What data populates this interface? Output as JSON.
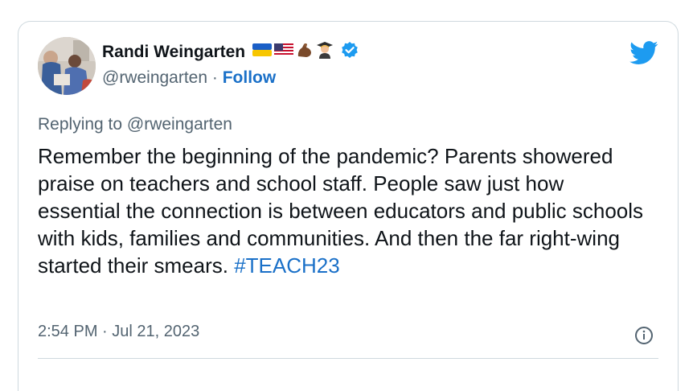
{
  "author": {
    "name": "Randi Weingarten",
    "handle": "@rweingarten",
    "separator": "·",
    "follow_label": "Follow",
    "emoji_icons": [
      "ukraine-flag-icon",
      "us-flag-icon",
      "flexed-biceps-icon",
      "graduate-icon"
    ],
    "verified": true
  },
  "tweet": {
    "replying_to": "Replying to @rweingarten",
    "text": "Remember the beginning of the pandemic? Parents showered praise on teachers and school staff. People saw just how essential the connection is between educators and public schools with kids, families and communities. And then the far right-wing started their smears.",
    "hashtag": "#TEACH23",
    "timestamp": "2:54 PM · Jul 21, 2023"
  },
  "colors": {
    "accent": "#1d9bf0",
    "link": "#1a70c8",
    "muted": "#536471",
    "text": "#0f1419",
    "border": "#cfd9de"
  }
}
